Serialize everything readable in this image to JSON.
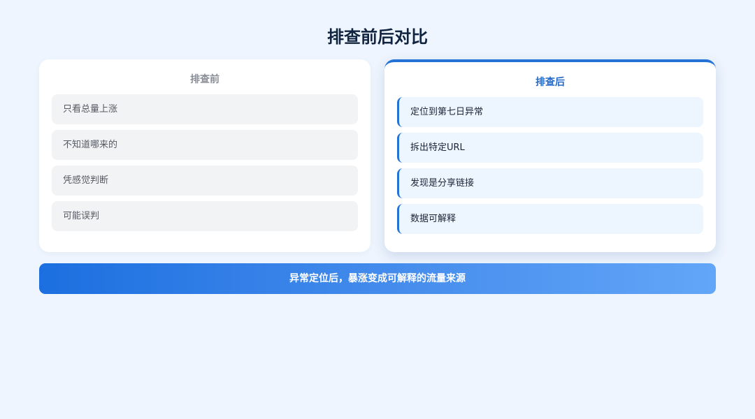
{
  "title": "排查前后对比",
  "before": {
    "heading": "排查前",
    "items": [
      "只看总量上涨",
      "不知道哪来的",
      "凭感觉判断",
      "可能误判"
    ]
  },
  "after": {
    "heading": "排查后",
    "items": [
      "定位到第七日异常",
      "拆出特定URL",
      "发现是分享链接",
      "数据可解释"
    ]
  },
  "conclusion": "异常定位后，暴涨变成可解释的流量来源",
  "colors": {
    "accent": "#2472d6",
    "background": "#eef5fe",
    "title": "#10233f",
    "muted": "#8a8f97"
  }
}
